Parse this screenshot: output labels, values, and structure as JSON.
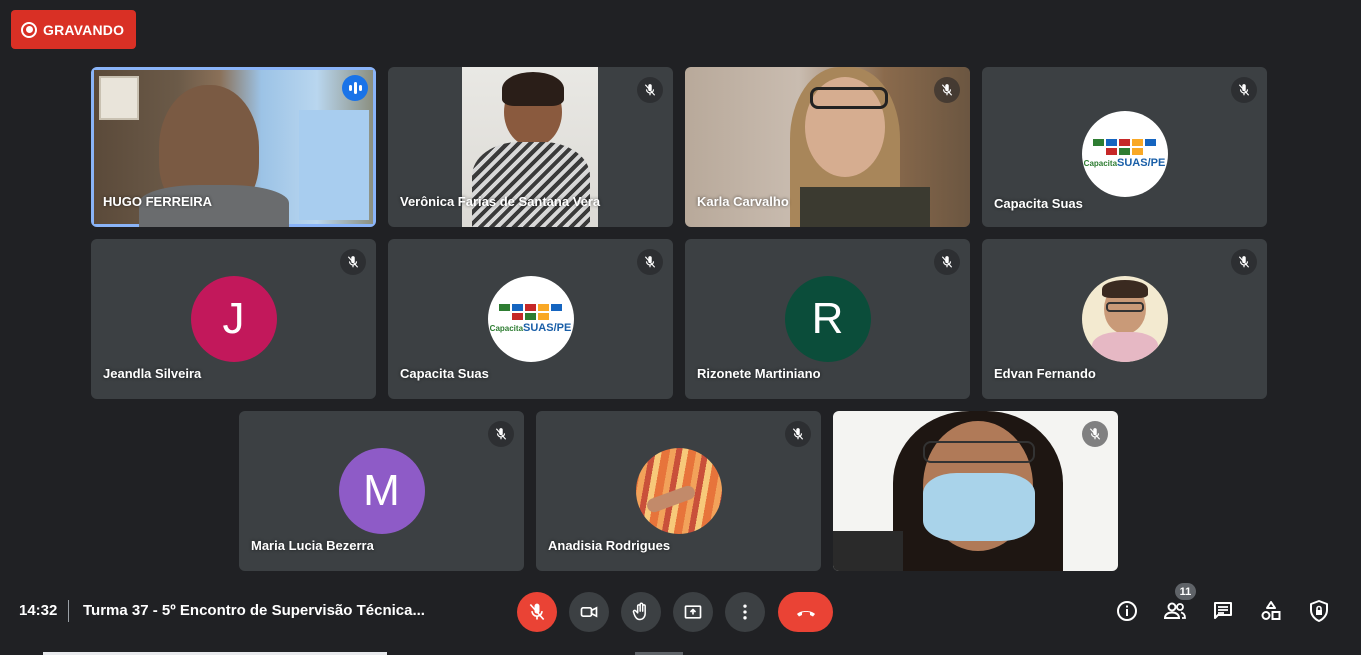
{
  "recording": {
    "label": "GRAVANDO"
  },
  "participants": [
    {
      "name": "HUGO FERREIRA"
    },
    {
      "name": "Verônica Farias de Santana Vera"
    },
    {
      "name": "Karla Carvalho"
    },
    {
      "name": "Capacita Suas"
    },
    {
      "name": "Jeandla Silveira",
      "initial": "J"
    },
    {
      "name": "Capacita Suas"
    },
    {
      "name": "Rizonete Martiniano",
      "initial": "R"
    },
    {
      "name": "Edvan Fernando"
    },
    {
      "name": "Maria Lucia Bezerra",
      "initial": "M"
    },
    {
      "name": "Anadisia Rodrigues"
    },
    {
      "name": ""
    }
  ],
  "logo": {
    "text": "SUAS/PE",
    "prefix": "Capacita"
  },
  "meeting": {
    "time": "14:32",
    "title": "Turma 37 - 5º Encontro de Supervisão Técnica..."
  },
  "people_count": "11",
  "colors": {
    "recording": "#d93025",
    "avatar_j": "#c2185b",
    "avatar_r": "#0b4d3a",
    "avatar_m": "#8e5bc7",
    "end_call": "#ea4335",
    "active_outline": "#8ab4f8"
  },
  "icons": [
    "record-icon",
    "speaking-icon",
    "mic-off-icon",
    "camera-icon",
    "raise-hand-icon",
    "present-icon",
    "more-options-icon",
    "end-call-icon",
    "info-icon",
    "people-icon",
    "chat-icon",
    "activities-icon",
    "host-controls-icon"
  ]
}
